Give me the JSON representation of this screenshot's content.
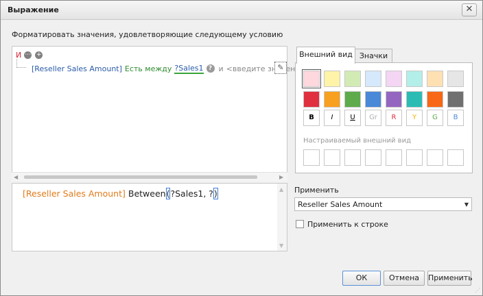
{
  "window": {
    "title": "Выражение",
    "close_glyph": "✕"
  },
  "subtitle": "Форматировать значения, удовлетворяющие следующему условию",
  "condition": {
    "group_operator": "И",
    "field": "[Reseller Sales Amount]",
    "operator": "Есть между",
    "param": "?Sales1",
    "help_glyph": "?",
    "and_word": "и",
    "placeholder": "<введите значение>"
  },
  "expression": {
    "field": "[Reseller Sales Amount]",
    "func": "Between",
    "open": "(",
    "args": "?Sales1, ?",
    "close": ")"
  },
  "tabs": {
    "appearance": "Внешний вид",
    "icons": "Значки"
  },
  "swatches": [
    "#ffd8de",
    "#fff3a8",
    "#d2ebb5",
    "#d6e8fb",
    "#f4d6f4",
    "#b4eee9",
    "#ffe0b3",
    "#e6e6e6",
    "#e0303f",
    "#f8a020",
    "#5eab4c",
    "#4a88d8",
    "#9566c0",
    "#2cbcb4",
    "#f86816",
    "#707070"
  ],
  "text_styles": [
    {
      "label": "B",
      "color": "#000000"
    },
    {
      "label": "I",
      "color": "#000000"
    },
    {
      "label": "U",
      "color": "#000000"
    },
    {
      "label": "Gr",
      "color": "#b0b0b0"
    },
    {
      "label": "R",
      "color": "#e0303f"
    },
    {
      "label": "Y",
      "color": "#f0b000"
    },
    {
      "label": "G",
      "color": "#5eab4c"
    },
    {
      "label": "B",
      "color": "#4a88d8"
    }
  ],
  "custom_appearance_label": "Настраиваемый внешний вид",
  "apply_to": {
    "label": "Применить",
    "value": "Reseller Sales Amount",
    "row_checkbox_label": "Применить к строке",
    "row_checked": false
  },
  "buttons": {
    "ok": "ОК",
    "cancel": "Отмена",
    "apply": "Применить"
  }
}
